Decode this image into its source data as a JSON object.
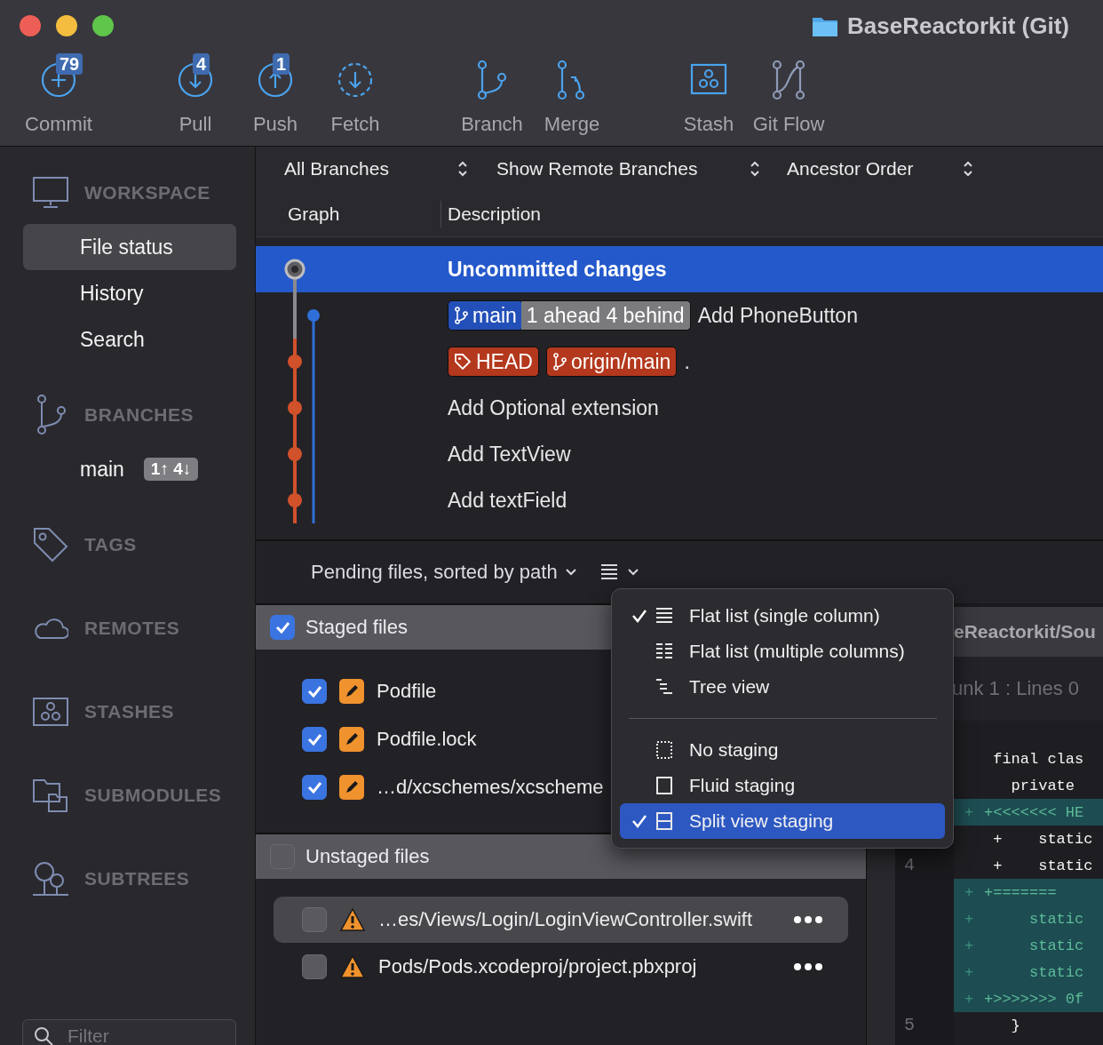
{
  "window": {
    "title": "BaseReactorkit (Git)"
  },
  "toolbar": {
    "groups": [
      {
        "items": [
          {
            "kind": "commit",
            "label": "Commit",
            "badge": "79"
          }
        ]
      },
      {
        "items": [
          {
            "kind": "pull",
            "label": "Pull",
            "badge": "4"
          },
          {
            "kind": "push",
            "label": "Push",
            "badge": "1"
          },
          {
            "kind": "fetch",
            "label": "Fetch"
          }
        ]
      },
      {
        "items": [
          {
            "kind": "branch",
            "label": "Branch"
          },
          {
            "kind": "merge",
            "label": "Merge"
          }
        ]
      },
      {
        "items": [
          {
            "kind": "stash",
            "label": "Stash"
          },
          {
            "kind": "gitflow",
            "label": "Git Flow"
          }
        ]
      }
    ]
  },
  "sidebar": {
    "sections": [
      {
        "kind": "workspace",
        "title": "WORKSPACE",
        "items": [
          {
            "label": "File status",
            "selected": true
          },
          {
            "label": "History",
            "selected": false
          },
          {
            "label": "Search",
            "selected": false
          }
        ]
      },
      {
        "kind": "branches",
        "title": "BRANCHES",
        "items": [
          {
            "label": "main",
            "badge": "1↑ 4↓",
            "selected": false
          }
        ]
      },
      {
        "kind": "tags",
        "title": "TAGS"
      },
      {
        "kind": "remotes",
        "title": "REMOTES"
      },
      {
        "kind": "stashes",
        "title": "STASHES"
      },
      {
        "kind": "submodules",
        "title": "SUBMODULES"
      },
      {
        "kind": "subtrees",
        "title": "SUBTREES"
      }
    ],
    "filter": {
      "placeholder": "Filter"
    }
  },
  "history": {
    "filters": [
      {
        "label": "All Branches"
      },
      {
        "label": "Show Remote Branches"
      },
      {
        "label": "Ancestor Order"
      }
    ],
    "columns": [
      "Graph",
      "Description"
    ],
    "commits": [
      {
        "kind": "uncommitted",
        "description": "Uncommitted changes",
        "selected": true
      },
      {
        "kind": "local",
        "tags": [
          {
            "kind": "branch",
            "label": "main",
            "color": "#2350b8"
          },
          {
            "kind": "tracking",
            "label": "1 ahead 4 behind",
            "color": "#7b7b7e"
          }
        ],
        "description": "Add PhoneButton",
        "selected": false
      },
      {
        "kind": "remote",
        "tags": [
          {
            "kind": "tag",
            "label": "HEAD",
            "color": "#b3381d"
          },
          {
            "kind": "branch",
            "label": "origin/main",
            "color": "#b3381d"
          }
        ],
        "description": ".",
        "selected": false
      },
      {
        "kind": "remote",
        "description": "Add Optional extension",
        "selected": false
      },
      {
        "kind": "remote",
        "description": "Add TextView",
        "selected": false
      },
      {
        "kind": "remote",
        "description": "Add textField",
        "selected": false
      }
    ]
  },
  "changes": {
    "title": "Pending files, sorted by path",
    "groups": [
      {
        "title": "Staged files",
        "checked": true,
        "files": [
          {
            "kind": "modified",
            "name": "Podfile",
            "checked": true,
            "selected": false
          },
          {
            "kind": "modified",
            "name": "Podfile.lock",
            "checked": true,
            "selected": false
          },
          {
            "kind": "modified",
            "name": "…d/xcschemes/xcscheme",
            "checked": true,
            "selected": false
          }
        ]
      },
      {
        "title": "Unstaged files",
        "checked": false,
        "files": [
          {
            "kind": "conflict",
            "name": "…es/Views/Login/LoginViewController.swift",
            "checked": false,
            "selected": true
          },
          {
            "kind": "conflict",
            "name": "Pods/Pods.xcodeproj/project.pbxproj",
            "checked": false,
            "selected": false
          }
        ]
      }
    ]
  },
  "diff": {
    "path": "eReactorkit/Sou",
    "hunk": "unk 1 : Lines 0",
    "lines": [
      {
        "kind": "context",
        "text": " final clas"
      },
      {
        "kind": "context",
        "text": "   private"
      },
      {
        "kind": "conflict",
        "marker": "+",
        "text": "+<<<<<<< HE"
      },
      {
        "kind": "added",
        "text": " +    static"
      },
      {
        "kind": "added",
        "number": "4",
        "text": " +    static"
      },
      {
        "kind": "conflict",
        "marker": "+",
        "text": "+======="
      },
      {
        "kind": "conflict",
        "marker": "+",
        "text": "     static"
      },
      {
        "kind": "conflict",
        "marker": "+",
        "text": "     static"
      },
      {
        "kind": "conflict",
        "marker": "+",
        "text": "     static"
      },
      {
        "kind": "conflict",
        "marker": "+",
        "text": "+>>>>>>> 0f"
      },
      {
        "kind": "context",
        "number": "5",
        "text": "   }"
      }
    ]
  },
  "view_menu": {
    "items": [
      {
        "kind": "list",
        "label": "Flat list (single column)",
        "checked": true,
        "selected": false
      },
      {
        "kind": "columns",
        "label": "Flat list (multiple columns)",
        "checked": false,
        "selected": false
      },
      {
        "kind": "tree",
        "label": "Tree view",
        "checked": false,
        "selected": false
      },
      {
        "kind": "separator"
      },
      {
        "kind": "none",
        "label": "No staging",
        "checked": false,
        "selected": false
      },
      {
        "kind": "fluid",
        "label": "Fluid staging",
        "checked": false,
        "selected": false
      },
      {
        "kind": "split",
        "label": "Split view staging",
        "checked": true,
        "selected": true
      }
    ]
  }
}
